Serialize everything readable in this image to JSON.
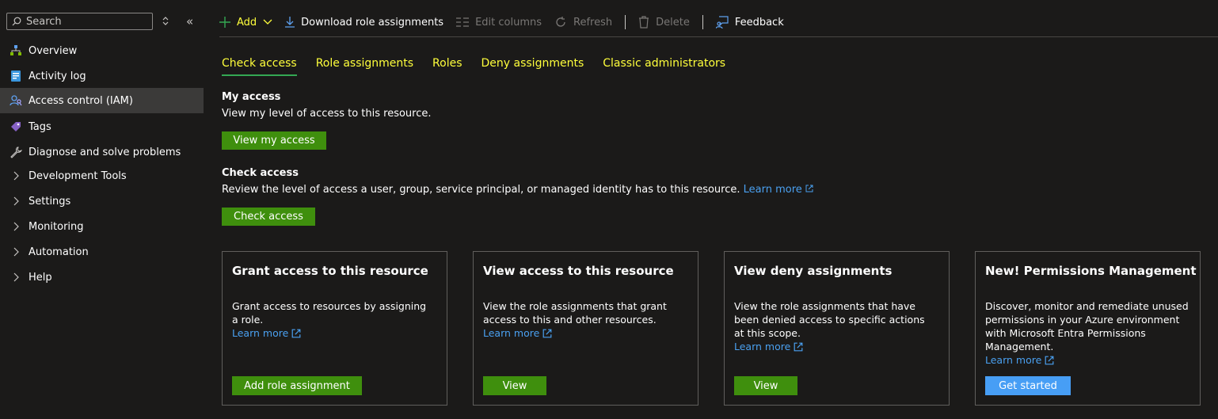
{
  "sidebar": {
    "search_placeholder": "Search",
    "items": [
      {
        "label": "Overview",
        "icon": "overview-icon"
      },
      {
        "label": "Activity log",
        "icon": "activity-log-icon"
      },
      {
        "label": "Access control (IAM)",
        "icon": "iam-icon",
        "active": true
      },
      {
        "label": "Tags",
        "icon": "tag-icon"
      },
      {
        "label": "Diagnose and solve problems",
        "icon": "wrench-icon"
      },
      {
        "label": "Development Tools",
        "expandable": true
      },
      {
        "label": "Settings",
        "expandable": true
      },
      {
        "label": "Monitoring",
        "expandable": true
      },
      {
        "label": "Automation",
        "expandable": true
      },
      {
        "label": "Help",
        "expandable": true
      }
    ]
  },
  "toolbar": {
    "add": "Add",
    "download": "Download role assignments",
    "edit_columns": "Edit columns",
    "refresh": "Refresh",
    "delete": "Delete",
    "feedback": "Feedback"
  },
  "tabs": [
    "Check access",
    "Role assignments",
    "Roles",
    "Deny assignments",
    "Classic administrators"
  ],
  "my_access": {
    "title": "My access",
    "text": "View my level of access to this resource.",
    "button": "View my access"
  },
  "check_access": {
    "title": "Check access",
    "text": "Review the level of access a user, group, service principal, or managed identity has to this resource.",
    "link": "Learn more",
    "button": "Check access"
  },
  "cards": [
    {
      "title": "Grant access to this resource",
      "desc": "Grant access to resources by assigning a role.",
      "link": "Learn more",
      "button": "Add role assignment"
    },
    {
      "title": "View access to this resource",
      "desc": "View the role assignments that grant access to this and other resources.",
      "link": "Learn more",
      "button": "View"
    },
    {
      "title": "View deny assignments",
      "desc": "View the role assignments that have been denied access to specific actions at this scope.",
      "link": "Learn more",
      "button": "View"
    },
    {
      "title": "New! Permissions Management",
      "desc": "Discover, monitor and remediate unused permissions in your Azure environment with Microsoft Entra Permissions Management.",
      "link": "Learn more",
      "button": "Get started"
    }
  ],
  "colors": {
    "accent_yellow": "#ffff3b",
    "button_green": "#3f8f0d",
    "button_blue": "#479ef5",
    "link_blue": "#4aa0f0"
  }
}
